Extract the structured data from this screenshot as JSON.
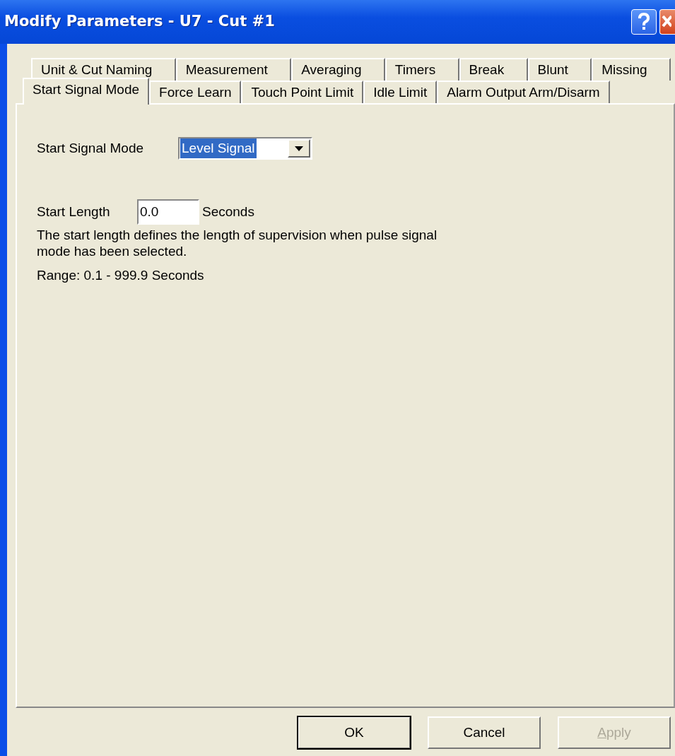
{
  "window": {
    "title": "Modify Parameters - U7 - Cut #1"
  },
  "tab_rows": [
    {
      "tabs": [
        {
          "label": "Unit & Cut Naming",
          "selected": false
        },
        {
          "label": "Measurement",
          "selected": false
        },
        {
          "label": "Averaging",
          "selected": false
        },
        {
          "label": "Timers",
          "selected": false
        },
        {
          "label": "Break",
          "selected": false
        },
        {
          "label": "Blunt",
          "selected": false
        },
        {
          "label": "Missing",
          "selected": false
        }
      ]
    },
    {
      "tabs": [
        {
          "label": "Start Signal Mode",
          "selected": true
        },
        {
          "label": "Force Learn",
          "selected": false
        },
        {
          "label": "Touch Point Limit",
          "selected": false
        },
        {
          "label": "Idle Limit",
          "selected": false
        },
        {
          "label": "Alarm Output Arm/Disarm",
          "selected": false
        }
      ]
    }
  ],
  "start_signal_mode": {
    "label": "Start Signal Mode",
    "value": "Level Signal",
    "highlighted": true
  },
  "start_length": {
    "label": "Start Length",
    "value": "0.0",
    "unit": "Seconds"
  },
  "description": "The start length defines the length of supervision when pulse signal mode has been selected.",
  "range": "Range: 0.1 - 999.9 Seconds",
  "buttons": [
    {
      "label": "OK",
      "default": true,
      "disabled": false
    },
    {
      "label": "Cancel",
      "default": false,
      "disabled": false
    },
    {
      "label": "Apply",
      "default": false,
      "disabled": true
    }
  ]
}
